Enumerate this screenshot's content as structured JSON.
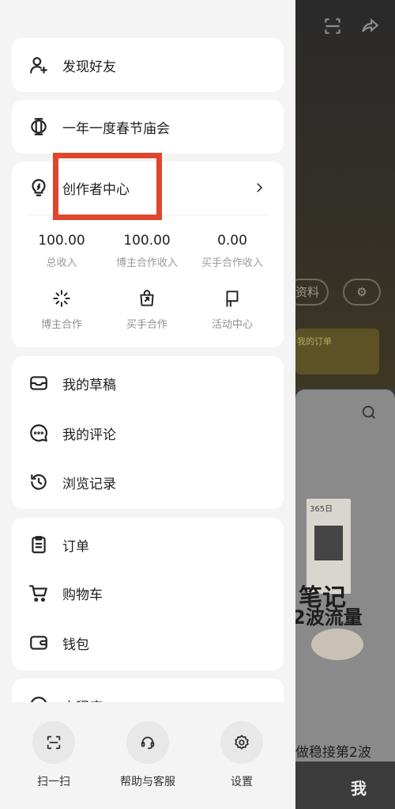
{
  "drawer": {
    "discover_friends": "发现好友",
    "spring_festival": "一年一度春节庙会",
    "creator_center": {
      "title": "创作者中心",
      "stats": [
        {
          "value": "100.00",
          "label": "总收入"
        },
        {
          "value": "100.00",
          "label": "博主合作收入"
        },
        {
          "value": "0.00",
          "label": "买手合作收入"
        }
      ],
      "tools": [
        {
          "label": "博主合作",
          "icon": "sparkle-icon"
        },
        {
          "label": "买手合作",
          "icon": "bag-icon"
        },
        {
          "label": "活动中心",
          "icon": "flag-icon"
        }
      ]
    },
    "content": [
      {
        "label": "我的草稿",
        "icon": "tray-icon"
      },
      {
        "label": "我的评论",
        "icon": "comment-icon"
      },
      {
        "label": "浏览记录",
        "icon": "history-icon"
      }
    ],
    "shopping": [
      {
        "label": "订单",
        "icon": "clipboard-icon"
      },
      {
        "label": "购物车",
        "icon": "cart-icon"
      },
      {
        "label": "钱包",
        "icon": "wallet-icon"
      }
    ],
    "mini_program_partial": "小程序"
  },
  "bottom_bar": [
    {
      "label": "扫一扫",
      "icon": "scan-icon"
    },
    {
      "label": "帮助与客服",
      "icon": "headset-icon"
    },
    {
      "label": "设置",
      "icon": "gear-icon"
    }
  ],
  "background": {
    "edit_profile_partial": "资料",
    "order_partial": "我的订单",
    "book_title": "365日",
    "big_text_1": "笔记",
    "big_text_2": "2波流量",
    "caption": "做稳接第2波",
    "tab_me": "我"
  },
  "colors": {
    "highlight": "#e0462c",
    "drawer_bg": "#f4f4f4",
    "card_bg": "#ffffff"
  }
}
